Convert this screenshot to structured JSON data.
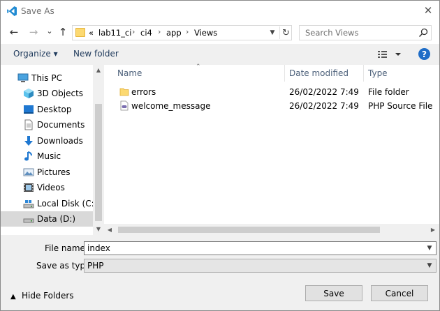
{
  "window": {
    "title": "Save As"
  },
  "nav": {
    "back": "←",
    "forward": "→",
    "recent": "⌄",
    "up": "↑",
    "breadcrumb_overflow": "«",
    "breadcrumbs": [
      "lab11_ci",
      "ci4",
      "app",
      "Views"
    ],
    "separator": "›",
    "refresh": "↻",
    "search_placeholder": "Search Views"
  },
  "toolbar": {
    "organize": "Organize ▾",
    "new_folder": "New folder",
    "help": "?"
  },
  "sidebar": {
    "items": [
      {
        "label": "This PC",
        "icon": "pc-icon"
      },
      {
        "label": "3D Objects",
        "icon": "cube-icon"
      },
      {
        "label": "Desktop",
        "icon": "desktop-icon"
      },
      {
        "label": "Documents",
        "icon": "documents-icon"
      },
      {
        "label": "Downloads",
        "icon": "downloads-icon"
      },
      {
        "label": "Music",
        "icon": "music-icon"
      },
      {
        "label": "Pictures",
        "icon": "pictures-icon"
      },
      {
        "label": "Videos",
        "icon": "videos-icon"
      },
      {
        "label": "Local Disk (C:)",
        "icon": "drive-icon"
      },
      {
        "label": "Data (D:)",
        "icon": "drive-icon",
        "selected": true
      }
    ]
  },
  "files": {
    "columns": {
      "name": "Name",
      "date": "Date modified",
      "type": "Type"
    },
    "rows": [
      {
        "name": "errors",
        "date": "26/02/2022 7:49",
        "type": "File folder",
        "icon": "folder-icon"
      },
      {
        "name": "welcome_message",
        "date": "26/02/2022 7:49",
        "type": "PHP Source File",
        "icon": "php-file-icon"
      }
    ]
  },
  "form": {
    "filename_label": "File name:",
    "filename_value": "index",
    "type_label": "Save as type:",
    "type_value": "PHP"
  },
  "buttons": {
    "save": "Save",
    "cancel": "Cancel",
    "hide_folders": "Hide Folders"
  },
  "colors": {
    "accent": "#1f6dc7",
    "folder": "#fcd971",
    "selected_bg": "#d9d9d9"
  }
}
